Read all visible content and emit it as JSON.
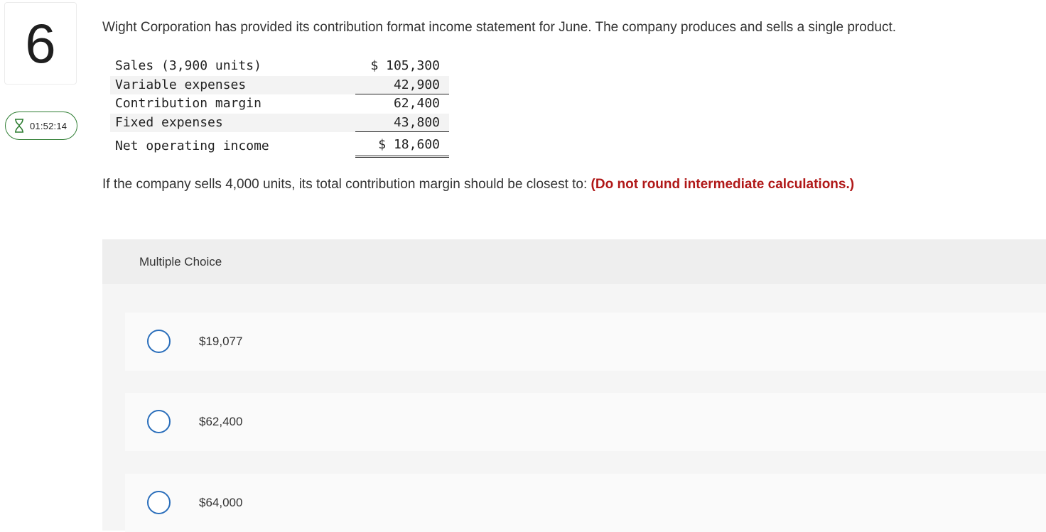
{
  "question": {
    "number": "6",
    "timer": "01:52:14",
    "text": "Wight Corporation has provided its contribution format income statement for June. The company produces and sells a single product.",
    "statement": [
      {
        "label": "Sales (3,900 units)",
        "value": "$ 105,300"
      },
      {
        "label": "Variable expenses",
        "value": "42,900"
      },
      {
        "label": "Contribution margin",
        "value": "62,400"
      },
      {
        "label": "Fixed expenses",
        "value": "43,800"
      },
      {
        "label": "Net operating income",
        "value": "$ 18,600"
      }
    ],
    "prompt": "If the company sells 4,000 units, its total contribution margin should be closest to:",
    "prompt_note": "(Do not round intermediate calculations.)"
  },
  "multiple_choice": {
    "title": "Multiple Choice",
    "options": [
      {
        "label": "$19,077"
      },
      {
        "label": "$62,400"
      },
      {
        "label": "$64,000"
      }
    ]
  },
  "colors": {
    "accent": "#2a6ebb",
    "note": "#b01818",
    "timer_border": "#2e7d32"
  }
}
